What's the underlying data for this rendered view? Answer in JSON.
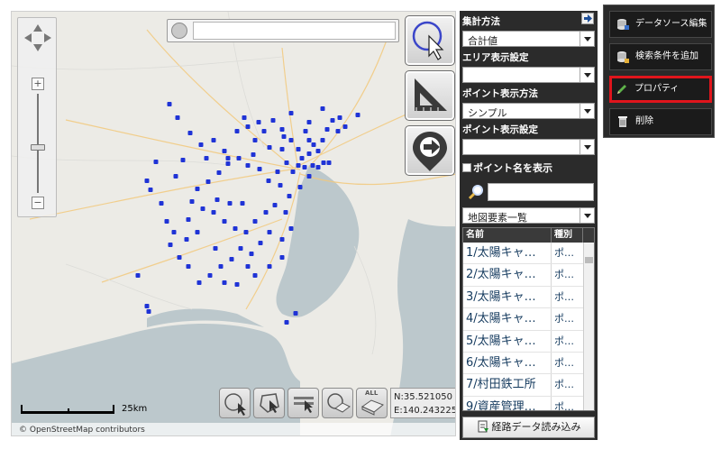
{
  "map": {
    "attribution": "© OpenStreetMap contributors",
    "scale_label": "25km",
    "coords": {
      "n": "N:35.521050",
      "e": "E:140.243225"
    },
    "bottom_tool_all_label": "ALL",
    "search_placeholder": "",
    "point_color": "#1f33d6"
  },
  "map_tools": [
    {
      "name": "select-tool",
      "icon": "select-cursor-icon"
    },
    {
      "name": "measure-tool",
      "icon": "triangle-ruler-icon"
    },
    {
      "name": "route-tool",
      "icon": "route-arrow-icon"
    }
  ],
  "panel": {
    "aggregation_label": "集計方法",
    "aggregation_value": "合計値",
    "area_label": "エリア表示設定",
    "area_value": "",
    "point_style_label": "ポイント表示方法",
    "point_style_value": "シンプル",
    "point_setting_label": "ポイント表示設定",
    "point_setting_value": "",
    "show_names_label": "ポイント名を表示",
    "list_search_placeholder": "",
    "element_list_label": "地図要素一覧",
    "table": {
      "headers": [
        "名前",
        "種別"
      ],
      "rows": [
        [
          "1/太陽キャ…",
          "ポ…"
        ],
        [
          "2/太陽キャ…",
          "ポ…"
        ],
        [
          "3/太陽キャ…",
          "ポ…"
        ],
        [
          "4/太陽キャ…",
          "ポ…"
        ],
        [
          "5/太陽キャ…",
          "ポ…"
        ],
        [
          "6/太陽キャ…",
          "ポ…"
        ],
        [
          "7/村田鉄工所",
          "ポ…"
        ],
        [
          "9/資産管理…",
          "ポ…"
        ]
      ]
    },
    "route_button": "経路データ読み込み"
  },
  "context_menu": {
    "items": [
      {
        "label": "データソース編集",
        "icon": "datasource-icon"
      },
      {
        "label": "検索条件を追加",
        "icon": "add-filter-icon"
      },
      {
        "label": "プロパティ",
        "icon": "pencil-icon",
        "highlighted": true
      },
      {
        "label": "削除",
        "icon": "trash-icon"
      }
    ],
    "highlight_color": "#e0151c"
  }
}
